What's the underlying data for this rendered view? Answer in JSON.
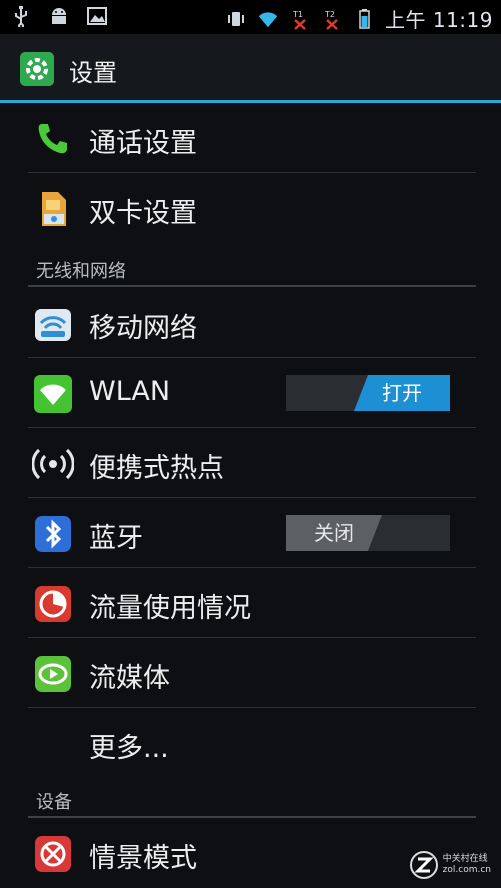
{
  "status_bar": {
    "time": "上午 11:19",
    "left_icons": [
      "usb-icon",
      "android-debug-icon",
      "image-icon"
    ],
    "right_icons": [
      "vibrate-icon",
      "wifi-icon",
      "sim1-no-signal-icon",
      "sim2-no-signal-icon",
      "battery-icon"
    ]
  },
  "title_bar": {
    "title": "设置",
    "icon": "settings-app-icon"
  },
  "items": {
    "call_settings": {
      "label": "通话设置",
      "icon": "phone-icon"
    },
    "dual_sim": {
      "label": "双卡设置",
      "icon": "sim-card-icon"
    },
    "section_wireless": "无线和网络",
    "mobile_network": {
      "label": "移动网络",
      "icon": "mobile-network-icon"
    },
    "wlan": {
      "label": "WLAN",
      "icon": "wlan-icon",
      "toggle": "打开",
      "state": "on"
    },
    "hotspot": {
      "label": "便携式热点",
      "icon": "hotspot-icon"
    },
    "bluetooth": {
      "label": "蓝牙",
      "icon": "bluetooth-icon",
      "toggle": "关闭",
      "state": "off"
    },
    "data_usage": {
      "label": "流量使用情况",
      "icon": "data-usage-icon"
    },
    "streaming": {
      "label": "流媒体",
      "icon": "streaming-icon"
    },
    "more": {
      "label": "更多..."
    },
    "section_device": "设备",
    "profiles": {
      "label": "情景模式",
      "icon": "profiles-icon"
    }
  },
  "watermark": {
    "text": "中关村在线",
    "site": "zol.com.cn"
  },
  "colors": {
    "accent": "#2ea7d6",
    "toggle_on": "#1d8fd3",
    "background": "#0d0f12"
  }
}
